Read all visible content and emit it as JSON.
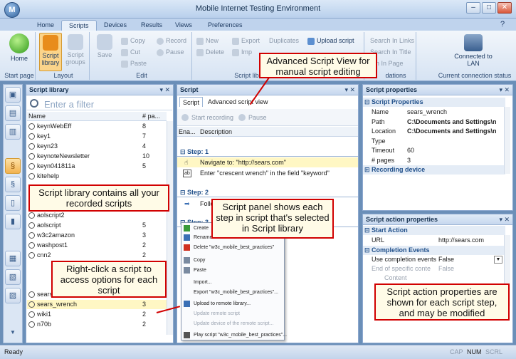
{
  "window": {
    "title": "Mobile Internet Testing Environment",
    "minimize": "–",
    "maximize": "□",
    "close": "✕",
    "help": "?"
  },
  "tabs": [
    "Home",
    "Scripts",
    "Devices",
    "Results",
    "Views",
    "Preferences"
  ],
  "ribbon": {
    "start_page": {
      "home": "Home",
      "group": "Start page"
    },
    "layout": {
      "script_library": "Script library",
      "script_groups": "Script groups",
      "group": "Layout"
    },
    "edit": {
      "save": "Save",
      "copy": "Copy",
      "cut": "Cut",
      "paste": "Paste",
      "record": "Record",
      "pause": "Pause",
      "group": "Edit"
    },
    "script_library": {
      "new": "New",
      "delete": "Delete",
      "export": "Export",
      "import": "Imp",
      "duplicates": "Duplicates",
      "upload": "Upload script",
      "group": "Script libr"
    },
    "validations": {
      "search_links": "Search In Links",
      "search_title": "Search In Title",
      "search_page": "h In Page",
      "group": "dations"
    },
    "connection": {
      "label": "Connected to LAN",
      "group": "Current connection status"
    }
  },
  "library": {
    "title": "Script library",
    "filter_placeholder": "Enter a filter",
    "col_name": "Name",
    "col_pages": "# pa...",
    "rows": [
      {
        "name": "keynWebEff",
        "pages": "8"
      },
      {
        "name": "key1",
        "pages": "7"
      },
      {
        "name": "keyn23",
        "pages": "4"
      },
      {
        "name": "keynoteNewsletter",
        "pages": "10"
      },
      {
        "name": "keyn041811a",
        "pages": "5"
      },
      {
        "name": "kitehelp",
        "pages": ""
      },
      {
        "name": "",
        "pages": ""
      },
      {
        "name": "",
        "pages": ""
      },
      {
        "name": "",
        "pages": ""
      },
      {
        "name": "aolscript2",
        "pages": ""
      },
      {
        "name": "aolscript",
        "pages": "5"
      },
      {
        "name": "w3c2amazon",
        "pages": "3"
      },
      {
        "name": "washpost1",
        "pages": "2"
      },
      {
        "name": "cnn2",
        "pages": "2"
      },
      {
        "name": "",
        "pages": ""
      },
      {
        "name": "",
        "pages": ""
      },
      {
        "name": "",
        "pages": ""
      },
      {
        "name": "sears2",
        "pages": "5"
      },
      {
        "name": "sears_wrench",
        "pages": "3"
      },
      {
        "name": "wiki1",
        "pages": "2"
      },
      {
        "name": "n70b",
        "pages": "2"
      }
    ]
  },
  "script": {
    "title": "Script",
    "tab_script": "Script",
    "tab_advanced": "Advanced script view",
    "start_recording": "Start recording",
    "pause": "Pause",
    "col_enabled": "Ena...",
    "col_description": "Description",
    "step1": "Step: 1",
    "step1_row1": "Navigate to: \"http://sears.com\"",
    "step1_row2": "Enter \"crescent wrench\" in the field \"keyword\"",
    "step2": "Step: 2",
    "step2_row1": "Follo",
    "step3": "Step: 3"
  },
  "context_menu": [
    {
      "label": "Create",
      "disabled": false
    },
    {
      "label": "Rename",
      "disabled": false
    },
    {
      "label": "Delete \"w3c_mobile_best_practices\"",
      "disabled": false
    },
    {
      "label": "Copy",
      "disabled": false
    },
    {
      "label": "Paste",
      "disabled": false
    },
    {
      "label": "Import...",
      "disabled": false
    },
    {
      "label": "Export \"w3c_mobile_best_practices\"...",
      "disabled": false
    },
    {
      "label": "Upload to remote library...",
      "disabled": false
    },
    {
      "label": "Update remote script",
      "disabled": true
    },
    {
      "label": "Update device of the remote script...",
      "disabled": true
    },
    {
      "label": "Play script \"w3c_mobile_best_practices\"...",
      "disabled": false
    }
  ],
  "properties": {
    "title": "Script properties",
    "section": "Script Properties",
    "rows": [
      {
        "k": "Name",
        "v": "sears_wrench"
      },
      {
        "k": "Path",
        "v": "C:\\Documents and Settings\\n"
      },
      {
        "k": "Location",
        "v": "C:\\Documents and Settings\\n"
      },
      {
        "k": "Type",
        "v": ""
      },
      {
        "k": "Timeout",
        "v": "60"
      },
      {
        "k": "# pages",
        "v": "3"
      }
    ],
    "section2": "Recording device"
  },
  "action_properties": {
    "title": "Script action properties",
    "section1": "Start Action",
    "url_k": "URL",
    "url_v": "http://sears.com",
    "section2": "Completion Events",
    "use_k": "Use completion events",
    "use_v": "False",
    "end_k": "End of specific conte",
    "end_v": "False",
    "content_k": "Content"
  },
  "status": {
    "left": "Ready",
    "cap": "CAP",
    "num": "NUM",
    "scrl": "SCRL"
  },
  "callouts": {
    "advanced": "Advanced Script View for manual script editing",
    "library": "Script library contains all your recorded scripts",
    "panel": "Script panel shows each step in script that's selected in Script library",
    "rightclick": "Right-click a script to access options for each script",
    "action": "Script action properties are shown for each script step, and may be modified"
  },
  "colors": {
    "accent": "#d10000",
    "selection": "#fff7c4"
  }
}
